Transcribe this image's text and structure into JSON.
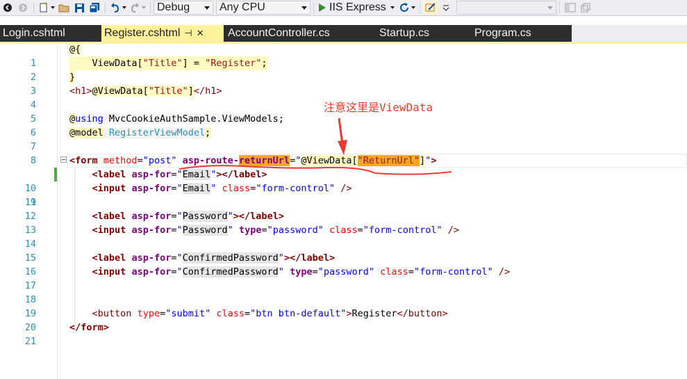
{
  "toolbar": {
    "config": "Debug",
    "platform": "Any CPU",
    "run_target": "IIS Express"
  },
  "tabs": [
    {
      "label": "Login.cshtml"
    },
    {
      "label": "Register.cshtml",
      "active": true
    },
    {
      "label": "AccountController.cs"
    },
    {
      "label": "Startup.cs"
    },
    {
      "label": "Program.cs"
    }
  ],
  "annotation": "注意这里是ViewData",
  "editor": {
    "line_numbers": [
      "1",
      "2",
      "3",
      "4",
      "5",
      "6",
      "7",
      "8",
      "9",
      "10",
      "11",
      "12",
      "13",
      "14",
      "15",
      "16",
      "17",
      "18",
      "19",
      "20",
      "21"
    ]
  },
  "icons": {
    "pin": "pin-icon",
    "close": "close-icon",
    "run": "play-icon"
  },
  "colors": {
    "active_tab": "#fff29d",
    "annotation_red": "#ee3a2e",
    "tab_strip": "#2d2d30"
  }
}
